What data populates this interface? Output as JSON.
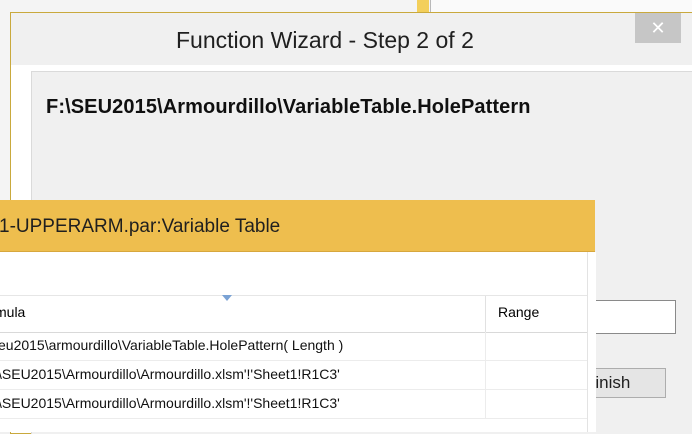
{
  "wizard": {
    "title": "Function Wizard - Step 2 of 2",
    "close_glyph": "✕",
    "path_text": "F:\\SEU2015\\Armourdillo\\VariableTable.HolePattern",
    "finish_label": "Finish"
  },
  "variable_table": {
    "title": "1-UPPERARM.par:Variable Table",
    "columns": {
      "formula": "mula",
      "range": "Range"
    },
    "rows": [
      {
        "formula": "eu2015\\armourdillo\\VariableTable.HolePattern( Length )",
        "range": ""
      },
      {
        "formula": "\\SEU2015\\Armourdillo\\Armourdillo.xlsm'!'Sheet1!R1C3'",
        "range": ""
      },
      {
        "formula": "\\SEU2015\\Armourdillo\\Armourdillo.xlsm'!'Sheet1!R1C3'",
        "range": ""
      }
    ]
  },
  "colors": {
    "titlebar_accent": "#eebe4e",
    "close_button": "#c6c6c6",
    "sort_indicator": "#7aa2d4"
  },
  "icons": {
    "close": "close-icon",
    "sort": "sort-indicator-icon"
  }
}
